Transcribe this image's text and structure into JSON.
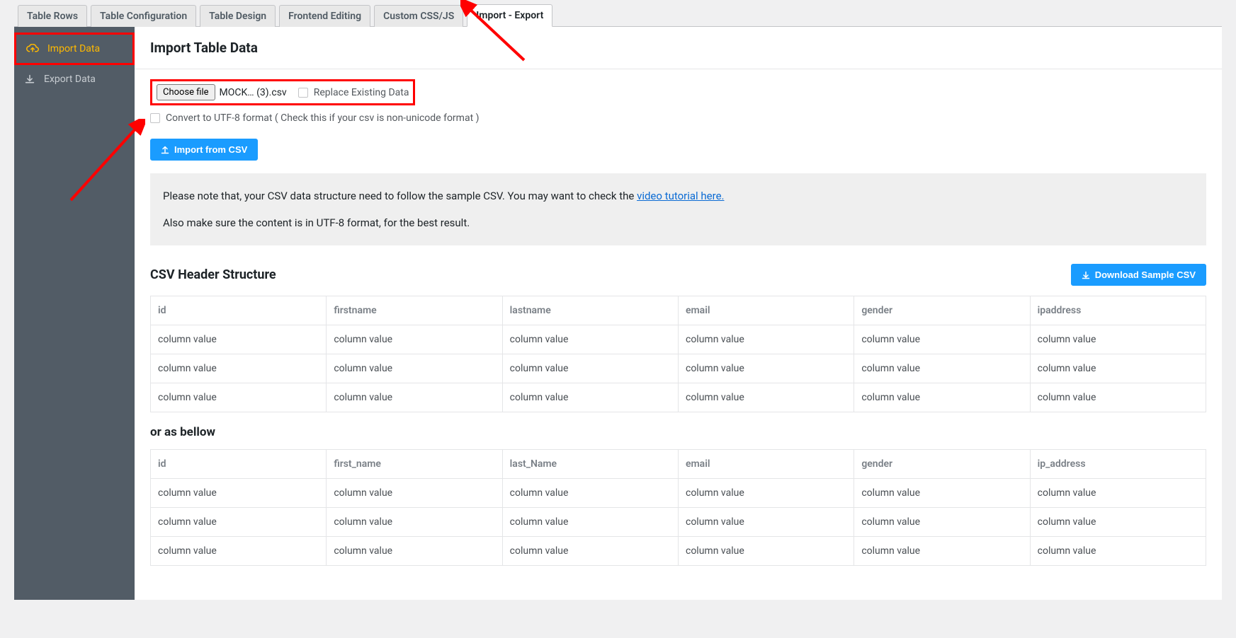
{
  "tabs": [
    {
      "label": "Table Rows"
    },
    {
      "label": "Table Configuration"
    },
    {
      "label": "Table Design"
    },
    {
      "label": "Frontend Editing"
    },
    {
      "label": "Custom CSS/JS"
    },
    {
      "label": "Import - Export",
      "active": true
    }
  ],
  "sidebar": {
    "items": [
      {
        "label": "Import Data",
        "active": true
      },
      {
        "label": "Export Data"
      }
    ]
  },
  "import": {
    "title": "Import Table Data",
    "choose_file_label": "Choose file",
    "file_name": "MOCK… (3).csv",
    "replace_label": "Replace Existing Data",
    "utf8_label": "Convert to UTF-8 format ( Check this if your csv is non-unicode format )",
    "import_button": "Import from CSV",
    "notice_line1_pre": "Please note that, your CSV data structure need to follow the sample CSV. You may want to check the ",
    "notice_link": "video tutorial here.",
    "notice_line2": "Also make sure the content is in UTF-8 format, for the best result.",
    "csv_header_title": "CSV Header Structure",
    "download_sample": "Download Sample CSV",
    "or_as_below": "or as bellow",
    "table1": {
      "headers": [
        "id",
        "firstname",
        "lastname",
        "email",
        "gender",
        "ipaddress"
      ],
      "cell": "column value",
      "rows": 3
    },
    "table2": {
      "headers": [
        "id",
        "first_name",
        "last_Name",
        "email",
        "gender",
        "ip_address"
      ],
      "cell": "column value",
      "rows": 3
    }
  }
}
